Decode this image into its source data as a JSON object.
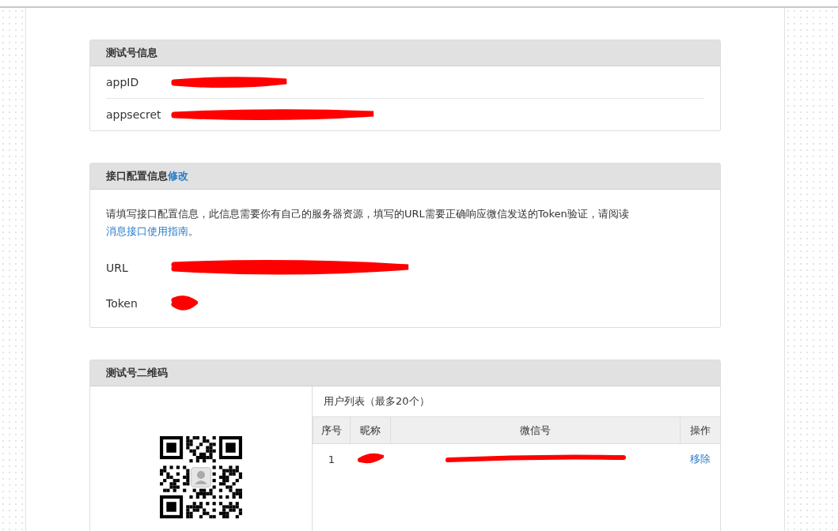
{
  "panels": [
    {
      "kind": "fields",
      "title": "测试号信息",
      "fields": [
        {
          "label": "appID",
          "redacted": true,
          "divider": true
        },
        {
          "label": "appsecret",
          "redacted": true,
          "divider": false
        }
      ]
    },
    {
      "kind": "config",
      "title": "接口配置信息",
      "title_link": "修改",
      "intro": "请填写接口配置信息，此信息需要你有自己的服务器资源，填写的URL需要正确响应微信发送的Token验证，请阅读",
      "intro_link": "消息接口使用指南",
      "intro_end": "。",
      "fields": [
        {
          "label": "URL",
          "redacted": true
        },
        {
          "label": "Token",
          "redacted": true
        }
      ]
    },
    {
      "kind": "qrcode",
      "title": "测试号二维码",
      "user_list": {
        "title": "用户列表（最多20个）",
        "columns": [
          "序号",
          "昵称",
          "微信号",
          "操作"
        ],
        "rows": [
          {
            "index": "1",
            "nickname_redacted": true,
            "wechat_id_redacted": true,
            "action": "移除"
          }
        ]
      }
    }
  ]
}
